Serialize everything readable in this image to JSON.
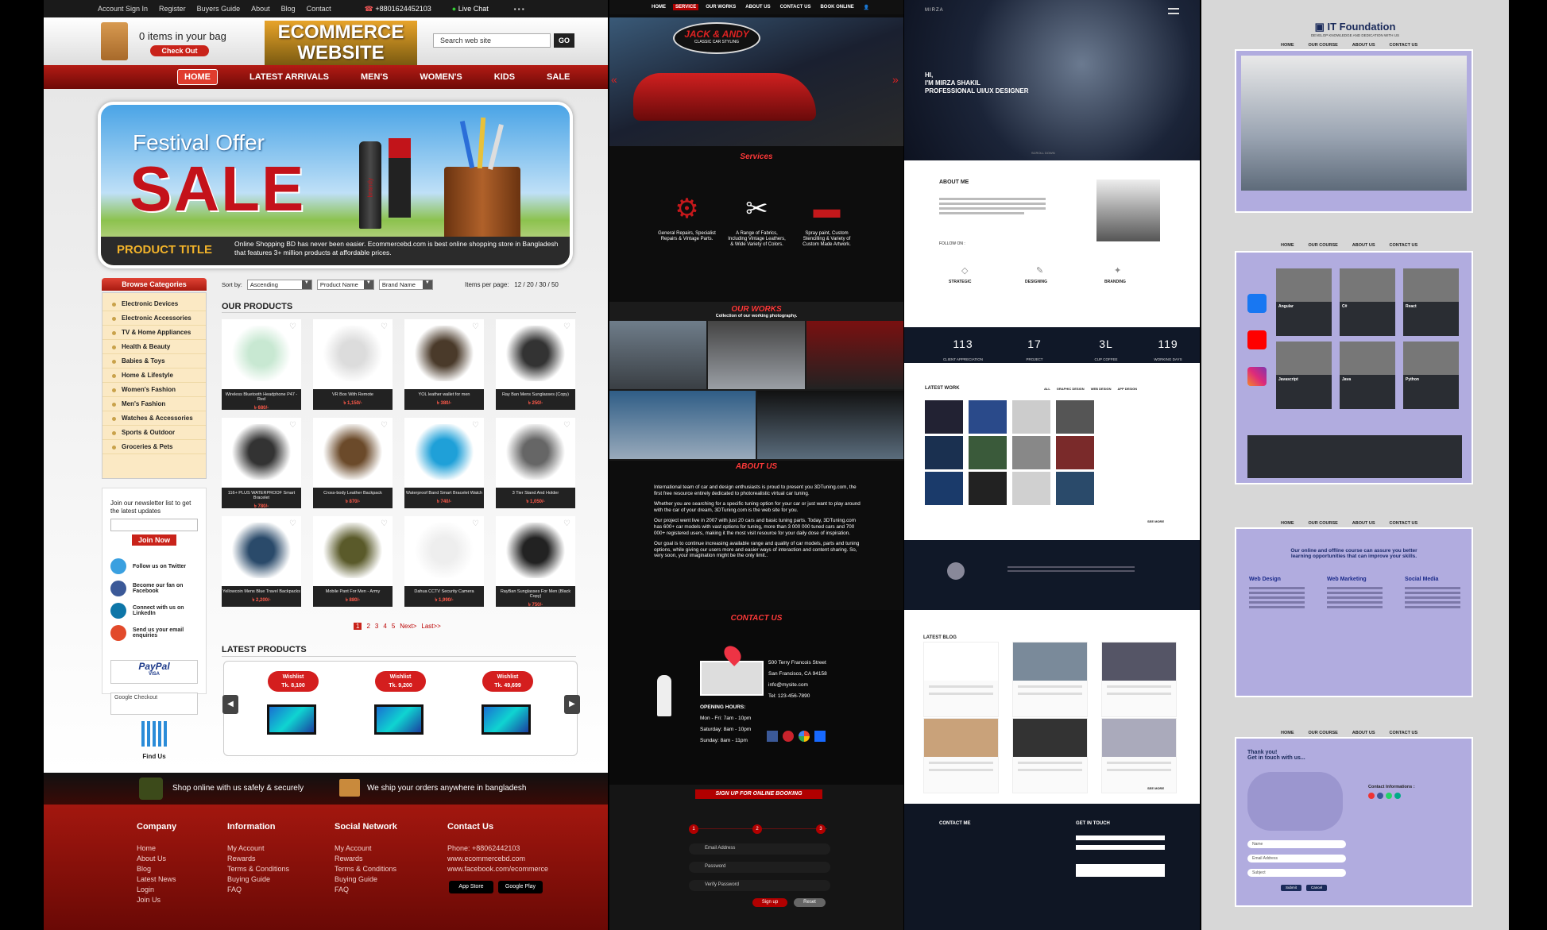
{
  "ecommerce": {
    "topbar": {
      "links": [
        "Account Sign In",
        "Register",
        "Buyers Guide",
        "About",
        "Blog",
        "Contact"
      ],
      "phone": "+8801624452103",
      "chat": "Live Chat"
    },
    "cart": {
      "items": "0 items in your bag",
      "checkout": "Check Out"
    },
    "logo": "ECOMMERCE WEBSITE",
    "search": {
      "placeholder": "Search web site",
      "go": "GO"
    },
    "nav": [
      "HOME",
      "LATEST ARRIVALS",
      "MEN'S",
      "WOMEN'S",
      "KIDS",
      "SALE"
    ],
    "banner": {
      "title1": "Festival Offer",
      "title2": "SALE",
      "product_title": "PRODUCT TITLE",
      "desc": "Online Shopping BD has never been easier. Ecommercebd.com is best online shopping store in Bangladesh that features 3+ million products at affordable prices.",
      "bottle_label": "brandy"
    },
    "categories": {
      "title": "Browse Categories",
      "items": [
        "Electronic Devices",
        "Electronic Accessories",
        "TV & Home Appliances",
        "Health & Beauty",
        "Babies & Toys",
        "Home & Lifestyle",
        "Women's Fashion",
        "Men's Fashion",
        "Watches & Accessories",
        "Sports & Outdoor",
        "Groceries & Pets"
      ]
    },
    "sort": {
      "label": "Sort by:",
      "by": "Ascending",
      "name": "Product Name",
      "brand": "Brand Name",
      "per_page": "Items per page:",
      "options": "12 / 20 / 30 / 50"
    },
    "our_products": "OUR PRODUCTS",
    "products": [
      {
        "name": "Wireless Bluetooth Headphone P47 - Red",
        "price": "৳ 680/-"
      },
      {
        "name": "VR Box With Remote",
        "price": "৳ 1,150/-"
      },
      {
        "name": "YOL leather wallet for men",
        "price": "৳ 380/-"
      },
      {
        "name": "Ray Ban Mens Sunglasses (Copy)",
        "price": "৳ 250/-"
      },
      {
        "name": "116+ PLUS WATERPROOF Smart Bracelet",
        "price": "৳ 780/-"
      },
      {
        "name": "Cross-body Leather Backpack",
        "price": "৳ 870/-"
      },
      {
        "name": "Waterproof Band Smart Bracelet Watch",
        "price": "৳ 740/-"
      },
      {
        "name": "3 Tier Stand And Holder",
        "price": "৳ 1,050/-"
      },
      {
        "name": "Yellowcoin Mens Blue Travel Backpacks",
        "price": "৳ 2,200/-"
      },
      {
        "name": "Mobile Pant For Men - Army",
        "price": "৳ 880/-"
      },
      {
        "name": "Dahua CCTV Security Camera",
        "price": "৳ 1,990/-"
      },
      {
        "name": "RayBan Sunglasses For Men (Black Copy)",
        "price": "৳ 750/-"
      }
    ],
    "pagination": [
      "1",
      "2",
      "3",
      "4",
      "5",
      "Next>",
      "Last>>"
    ],
    "latest": {
      "title": "LATEST PRODUCTS",
      "items": [
        {
          "tag": "Wishlist",
          "price": "Tk. 8,100"
        },
        {
          "tag": "Wishlist",
          "price": "Tk. 9,200"
        },
        {
          "tag": "Wishlist",
          "price": "Tk. 49,699"
        }
      ]
    },
    "newsletter": {
      "text": "Join our newsletter list to get the latest updates",
      "button": "Join Now"
    },
    "social": [
      {
        "label": "Follow us on Twitter"
      },
      {
        "label": "Become our fan on Facebook"
      },
      {
        "label": "Connect with us on LinkedIn"
      },
      {
        "label": "Send us your email enquiries"
      }
    ],
    "pay": {
      "paypal": "PayPal",
      "gcheckout": "Google Checkout",
      "qr": "Find Us",
      "visa": "VISA"
    },
    "safe_bar": {
      "safe": "Shop online with us safely & securely",
      "ship": "We ship your orders anywhere in bangladesh"
    },
    "footer": {
      "company": {
        "title": "Company",
        "links": [
          "Home",
          "About Us",
          "Blog",
          "Latest News",
          "Login",
          "Join Us"
        ]
      },
      "information": {
        "title": "Information",
        "links": [
          "My Account",
          "Rewards",
          "Terms & Conditions",
          "Buying Guide",
          "FAQ"
        ]
      },
      "social": {
        "title": "Social Network",
        "links": [
          "My Account",
          "Rewards",
          "Terms & Conditions",
          "Buying Guide",
          "FAQ"
        ]
      },
      "contact": {
        "title": "Contact Us",
        "lines": [
          "Phone: +88062442103",
          "www.ecommercebd.com",
          "www.facebook.com/ecommerce"
        ],
        "appstore": "App Store",
        "googleplay": "Google Play"
      }
    }
  },
  "jackandy": {
    "nav": [
      "HOME",
      "SERVICE",
      "OUR WORKS",
      "ABOUT US",
      "CONTACT US",
      "BOOK ONLINE"
    ],
    "logo": "JACK & ANDY",
    "logo_sub": "CLASSIC CAR STYLING",
    "services_title": "Services",
    "services": [
      "General Repairs, Specialist Repairs & Vintage Parts.",
      "A Range of Fabrics, Including Vintage Leathers, & Wide Variety of Colors.",
      "Spray paint, Custom Stencilling & Variety of Custom Made Artwork."
    ],
    "works_title": "OUR WORKS",
    "works_sub": "Collection of our working photography.",
    "about_title": "ABOUT US",
    "about_text": [
      "International team of car and design enthusiasts is proud to present you 3DTuning.com, the first free resource entirely dedicated to photorealistic virtual car tuning.",
      "Whether you are searching for a specific tuning option for your car or just want to play around with the car of your dream, 3DTuning.com is the web site for you.",
      "Our project went live in 2007 with just 20 cars and basic tuning parts. Today, 3DTuning.com has 600+ car models with vast options for tuning, more than 3 000 000 tuned cars and 700 000+ registered users, making it the most visit resource for your daily dose of inspiration.",
      "Our goal is to continue increasing available range and quality of car models, parts and tuning options, while giving our users more and easier ways of interaction and content sharing. So, very soon, your imagination might be the only limit.."
    ],
    "contact_title": "CONTACT US",
    "contact": [
      "500 Terry Francois Street",
      "San Francisco, CA 94158",
      "info@mysite.com",
      "Tel: 123-456-7890"
    ],
    "hours_title": "OPENING HOURS:",
    "hours": [
      "Mon - Fri: 7am - 10pm",
      "Saturday: 8am - 10pm",
      "Sunday: 8am - 11pm"
    ],
    "booking_title": "SIGN UP FOR ONLINE BOOKING",
    "steps": [
      "1",
      "2",
      "3"
    ],
    "fields": [
      "Email Address",
      "Password",
      "Verify Password"
    ],
    "buttons": [
      "Sign up",
      "Reset"
    ]
  },
  "mirza": {
    "brand": "MIRZA",
    "hero": [
      "HI,",
      "I'M MIRZA SHAKIL",
      "PROFESSIONAL UI/UX DESIGNER"
    ],
    "scroll": "SCROLL DOWN",
    "about_title": "ABOUT ME",
    "follow": "FOLLOW ON :",
    "skills": [
      "STRATEGIC",
      "DESIGNING",
      "BRANDING"
    ],
    "stats": [
      {
        "n": "113",
        "l": "CLIENT APPRECIATION"
      },
      {
        "n": "17",
        "l": "PROJECT"
      },
      {
        "n": "3L",
        "l": "CUP COFFEE"
      },
      {
        "n": "119",
        "l": "WORKING DAYS"
      }
    ],
    "work_title": "LATEST WORK",
    "work_filters": [
      "ALL",
      "GRAPHIC DESIGN",
      "WEB DESIGN",
      "APP DESIGN"
    ],
    "see_more": "SEE MORE",
    "blog_title": "LATEST BLOG",
    "contact_title": "CONTACT ME",
    "get_in_touch": "GET IN TOUCH"
  },
  "itf": {
    "logo": "IT Foundation",
    "tagline": "DEVELOP KNOWLEDGE AND DEDICATION WITH US",
    "nav": [
      "HOME",
      "OUR COURSE",
      "ABOUT US",
      "CONTACT US"
    ],
    "courses": [
      "Angular",
      "C#",
      "React",
      "Javascript",
      "Java",
      "Python"
    ],
    "headline2": "Our online and offline course can assure you better learning opportunities that can improve your skills.",
    "cols": [
      "Web Design",
      "Web Marketing",
      "Social Media"
    ],
    "thanks": "Thank you!",
    "touch": "Get in touch with us...",
    "contact_info": "Contact Informations :",
    "fields": [
      "Name",
      "Email Address",
      "Subject"
    ],
    "buttons": [
      "Submit",
      "Cancel"
    ]
  }
}
